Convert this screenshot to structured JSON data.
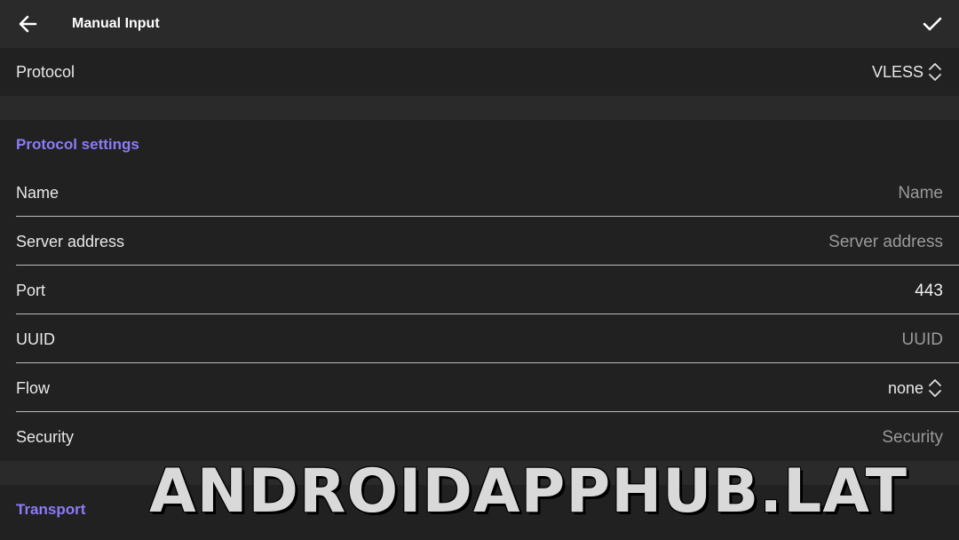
{
  "appbar": {
    "title": "Manual Input",
    "back_icon": "arrow-left-icon",
    "confirm_icon": "check-icon"
  },
  "protocol": {
    "label": "Protocol",
    "value": "VLESS"
  },
  "protocol_settings": {
    "header": "Protocol settings",
    "name": {
      "label": "Name",
      "placeholder": "Name"
    },
    "server_address": {
      "label": "Server address",
      "placeholder": "Server address"
    },
    "port": {
      "label": "Port",
      "value": "443"
    },
    "uuid": {
      "label": "UUID",
      "placeholder": "UUID"
    },
    "flow": {
      "label": "Flow",
      "value": "none"
    },
    "security": {
      "label": "Security",
      "placeholder": "Security"
    }
  },
  "transport": {
    "header": "Transport"
  },
  "watermark": "ANDROIDAPPHUB.LAT",
  "colors": {
    "background": "#212121",
    "appbar": "#2a2a2a",
    "accent": "#8b7cf6"
  }
}
